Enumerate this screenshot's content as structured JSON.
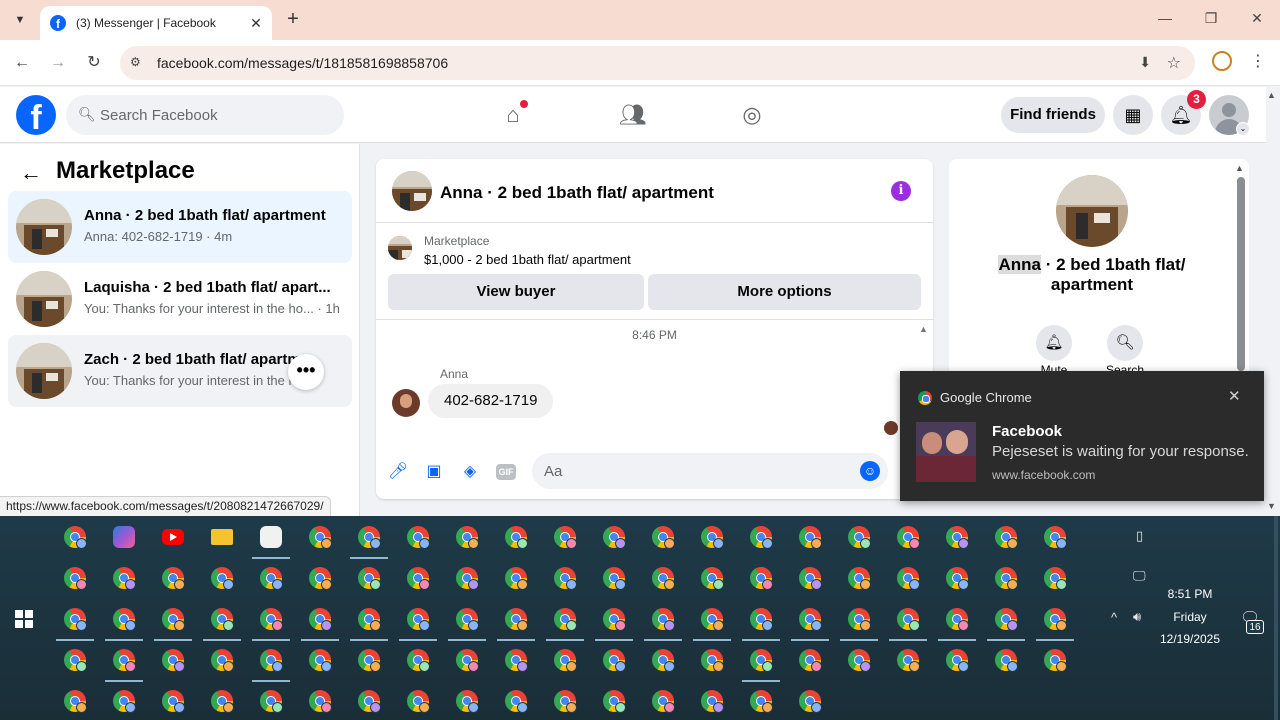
{
  "browser": {
    "tab_title": "(3) Messenger | Facebook",
    "url": "facebook.com/messages/t/1818581698858706",
    "status_url": "https://www.facebook.com/messages/t/2080821472667029/"
  },
  "fb": {
    "search_placeholder": "Search Facebook",
    "find_friends": "Find friends",
    "notif_count": "3"
  },
  "sidebar": {
    "title": "Marketplace",
    "conversations": [
      {
        "name": "Anna · 2 bed 1bath flat/ apartment",
        "sub": "Anna: 402-682-1719 · 4m",
        "active": true
      },
      {
        "name": "Laquisha · 2 bed 1bath flat/ apart...",
        "sub": "You: Thanks for your interest in the ho... · 1h",
        "active": false
      },
      {
        "name": "Zach · 2 bed 1bath flat/ apartm",
        "sub": "You: Thanks for your interest in the h",
        "active": false
      }
    ]
  },
  "chat": {
    "title": "Anna · 2 bed 1bath flat/ apartment",
    "marketplace_label": "Marketplace",
    "listing": "$1,000 - 2 bed 1bath flat/ apartment",
    "view_buyer": "View buyer",
    "more_options": "More options",
    "time_divider": "8:46 PM",
    "sender": "Anna",
    "message": "402-682-1719",
    "composer_placeholder": "Aa",
    "gif_label": "GIF"
  },
  "info_panel": {
    "name_highlight": "Anna",
    "name_rest": " · 2 bed 1bath flat/ apartment",
    "mute_label": "Mute",
    "search_label": "Search"
  },
  "toast": {
    "app": "Google Chrome",
    "title": "Facebook",
    "body": "Pejeseset is waiting for your response.",
    "source": "www.facebook.com"
  },
  "clock": {
    "time": "8:51 PM",
    "day": "Friday",
    "date": "12/19/2025",
    "notification_count": "16"
  },
  "colors": {
    "fb_blue": "#0866ff",
    "active_conv": "#ebf5ff",
    "info_purple": "#9b2fe0",
    "badge_red": "#e41e3f"
  }
}
